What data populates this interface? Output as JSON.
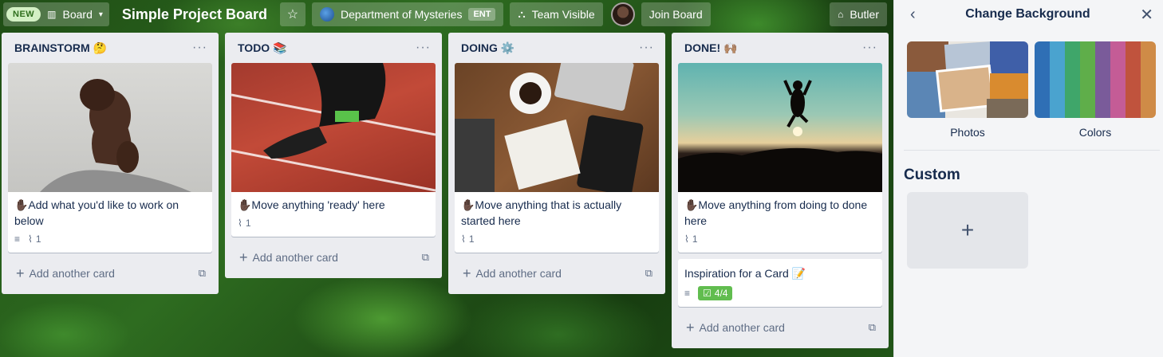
{
  "header": {
    "new_badge": "NEW",
    "board_switch_label": "Board",
    "board_title": "Simple Project Board",
    "workspace": "Department of Mysteries",
    "workspace_badge": "ENT",
    "visibility": "Team Visible",
    "join_label": "Join Board",
    "butler_label": "Butler"
  },
  "lists": [
    {
      "title": "BRAINSTORM 🤔",
      "cards": [
        {
          "text": "✋🏿Add what you'd like to work on below",
          "attachments": "1",
          "has_description": true
        }
      ],
      "add_label": "Add another card"
    },
    {
      "title": "TODO 📚",
      "cards": [
        {
          "text": "✋🏿Move anything 'ready' here",
          "attachments": "1",
          "has_description": false
        }
      ],
      "add_label": "Add another card"
    },
    {
      "title": "DOING ⚙️",
      "cards": [
        {
          "text": "✋🏿Move anything that is actually started here",
          "attachments": "1",
          "has_description": false
        }
      ],
      "add_label": "Add another card"
    },
    {
      "title": "DONE! 🙌🏽",
      "cards": [
        {
          "text": "✋🏿Move anything from doing to done here",
          "attachments": "1",
          "has_description": false
        },
        {
          "text": "Inspiration for a Card 📝",
          "checklist": "4/4",
          "has_description": true
        }
      ],
      "add_label": "Add another card"
    }
  ],
  "panel": {
    "title": "Change Background",
    "photos_label": "Photos",
    "colors_label": "Colors",
    "custom_heading": "Custom",
    "swatches": [
      "#2f6fb5",
      "#4aa3cf",
      "#3fa66a",
      "#5fae4a",
      "#7a5b9a",
      "#c45c96",
      "#c0533d",
      "#cf8b47"
    ]
  },
  "colors": {
    "checklist_complete": "#61bd4f",
    "list_bg": "#ebecf0"
  }
}
